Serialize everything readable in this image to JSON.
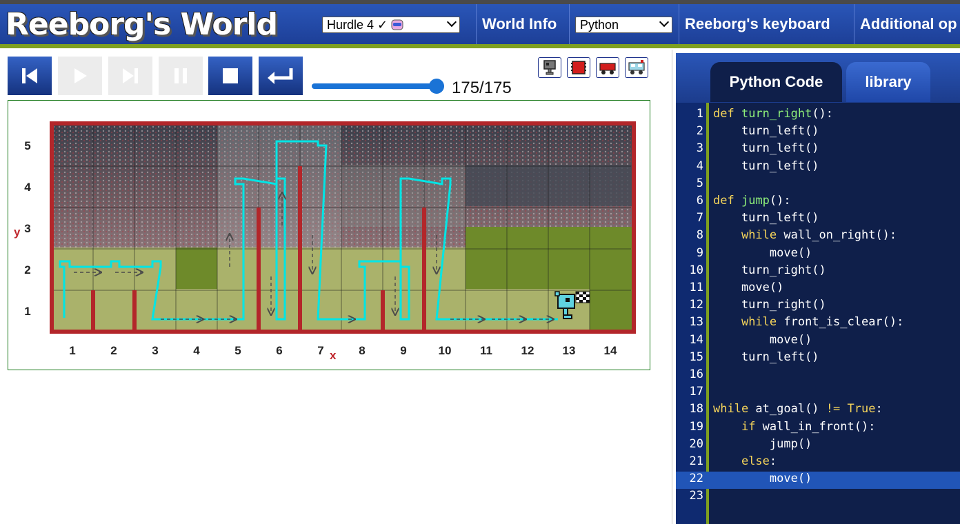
{
  "header": {
    "app_title": "Reeborg's World",
    "world_select": "Hurdle 4 ✓",
    "world_info": "World Info",
    "language_select": "Python",
    "keyboard": "Reeborg's keyboard",
    "additional": "Additional op"
  },
  "controls": {
    "step_counter": "175/175",
    "slider_fraction": 1.0
  },
  "world": {
    "y_axis_label": "y",
    "x_axis_label": "x",
    "x_ticks": [
      "1",
      "2",
      "3",
      "4",
      "5",
      "6",
      "7",
      "8",
      "9",
      "10",
      "11",
      "12",
      "13",
      "14"
    ],
    "y_ticks": [
      "1",
      "2",
      "3",
      "4",
      "5"
    ],
    "colors": {
      "wall": "#b3262a",
      "trace": "#00e5e5",
      "grid": "#1a1a1a",
      "frame": "#1a7a1a"
    }
  },
  "editor": {
    "tabs": [
      "Python Code",
      "library"
    ],
    "active_line": 22,
    "lines": [
      {
        "n": "1",
        "t": "def turn_right():"
      },
      {
        "n": "2",
        "t": "    turn_left()"
      },
      {
        "n": "3",
        "t": "    turn_left()"
      },
      {
        "n": "4",
        "t": "    turn_left()"
      },
      {
        "n": "5",
        "t": ""
      },
      {
        "n": "6",
        "t": "def jump():"
      },
      {
        "n": "7",
        "t": "    turn_left()"
      },
      {
        "n": "8",
        "t": "    while wall_on_right():"
      },
      {
        "n": "9",
        "t": "        move()"
      },
      {
        "n": "10",
        "t": "    turn_right()"
      },
      {
        "n": "11",
        "t": "    move()"
      },
      {
        "n": "12",
        "t": "    turn_right()"
      },
      {
        "n": "13",
        "t": "    while front_is_clear():"
      },
      {
        "n": "14",
        "t": "        move()"
      },
      {
        "n": "15",
        "t": "    turn_left()"
      },
      {
        "n": "16",
        "t": ""
      },
      {
        "n": "17",
        "t": ""
      },
      {
        "n": "18",
        "t": "while at_goal() != True:"
      },
      {
        "n": "19",
        "t": "    if wall_in_front():"
      },
      {
        "n": "20",
        "t": "        jump()"
      },
      {
        "n": "21",
        "t": "    else:"
      },
      {
        "n": "22",
        "t": "        move()"
      },
      {
        "n": "23",
        "t": ""
      }
    ]
  }
}
